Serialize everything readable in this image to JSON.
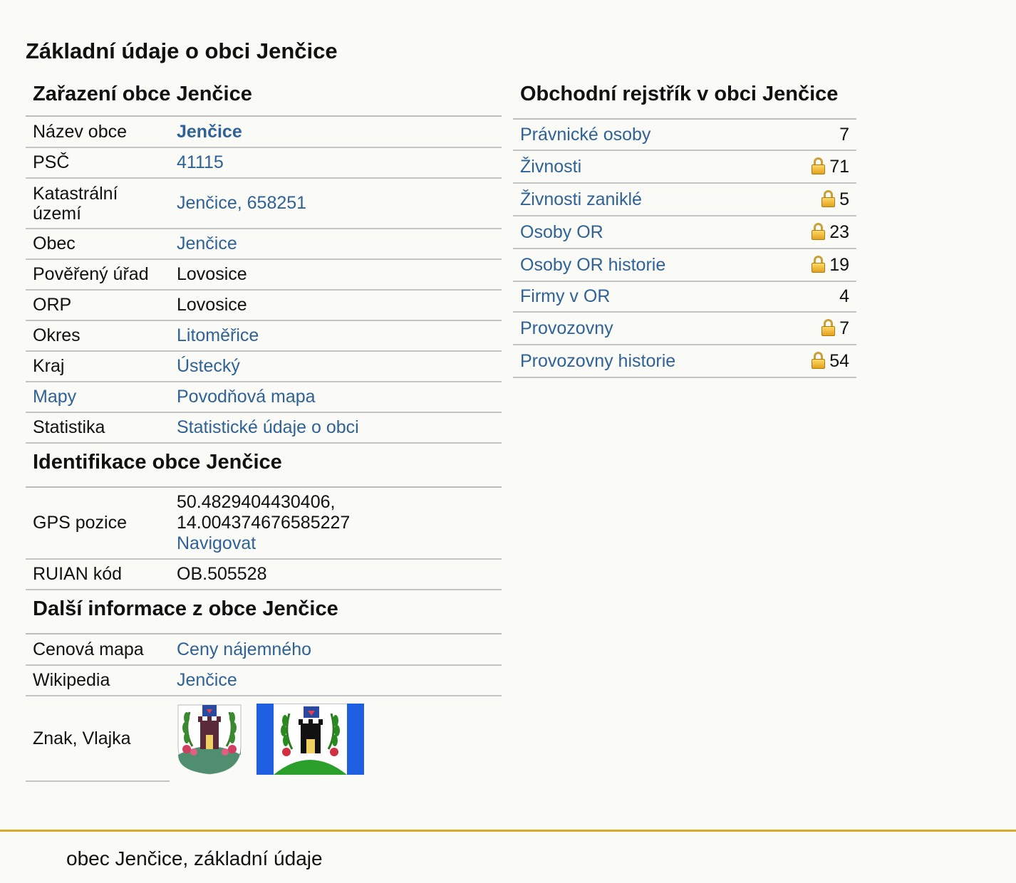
{
  "page_title": "Základní údaje o obci Jenčice",
  "zarazeni": {
    "heading": "Zařazení obce Jenčice",
    "rows": [
      {
        "label": "Název obce",
        "value": "Jenčice"
      },
      {
        "label": "PSČ",
        "value": "41115"
      },
      {
        "label": "Katastrální území",
        "value": "Jenčice, 658251"
      },
      {
        "label": "Obec",
        "value": "Jenčice"
      },
      {
        "label": "Pověřený úřad",
        "value": "Lovosice"
      },
      {
        "label": "ORP",
        "value": "Lovosice"
      },
      {
        "label": "Okres",
        "value": "Litoměřice"
      },
      {
        "label": "Kraj",
        "value": "Ústecký"
      },
      {
        "label": "Mapy",
        "value": "Povodňová mapa"
      },
      {
        "label": "Statistika",
        "value": "Statistické údaje o obci"
      }
    ]
  },
  "identifikace": {
    "heading": "Identifikace obce Jenčice",
    "gps_label": "GPS pozice",
    "gps_lat": "50.4829404430406,",
    "gps_lon": "14.004374676585227",
    "gps_link": "Navigovat",
    "ruian_label": "RUIAN kód",
    "ruian_value": "OB.505528"
  },
  "dalsi": {
    "heading": "Další informace z obce Jenčice",
    "rows": [
      {
        "label": "Cenová mapa",
        "value": "Ceny nájemného"
      },
      {
        "label": "Wikipedia",
        "value": "Jenčice"
      }
    ],
    "emblem_label": "Znak, Vlajka"
  },
  "rejstrik": {
    "heading": "Obchodní rejstřík v obci Jenčice",
    "rows": [
      {
        "label": "Právnické osoby",
        "value": "7",
        "locked": false
      },
      {
        "label": "Živnosti",
        "value": "71",
        "locked": true
      },
      {
        "label": "Živnosti zaniklé",
        "value": "5",
        "locked": true
      },
      {
        "label": "Osoby OR",
        "value": "23",
        "locked": true
      },
      {
        "label": "Osoby OR historie",
        "value": "19",
        "locked": true
      },
      {
        "label": "Firmy v OR",
        "value": "4",
        "locked": false
      },
      {
        "label": "Provozovny",
        "value": "7",
        "locked": true
      },
      {
        "label": "Provozovny historie",
        "value": "54",
        "locked": true
      }
    ]
  },
  "footer": "obec Jenčice, základní údaje",
  "colors": {
    "link": "#2f6296",
    "accent": "#d9ab2b",
    "background": "#fafaf6"
  }
}
